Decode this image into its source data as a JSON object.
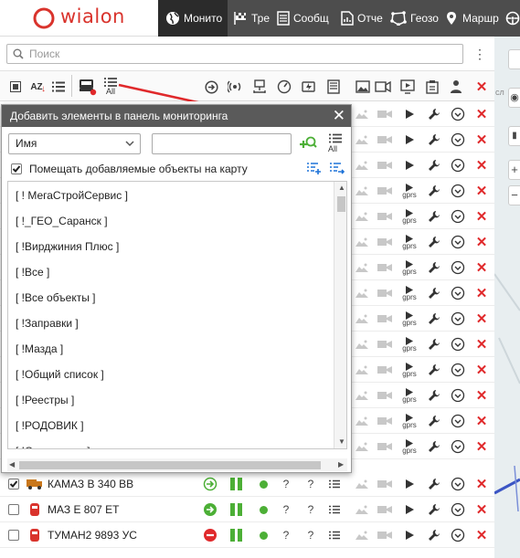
{
  "header": {
    "logo_text": "wialon",
    "tabs": [
      {
        "label": "Монито",
        "icon": "globe-icon"
      },
      {
        "label": "Тре",
        "icon": "flag-icon"
      },
      {
        "label": "Сообщ",
        "icon": "messages-icon"
      },
      {
        "label": "Отче",
        "icon": "reports-icon"
      },
      {
        "label": "Геозо",
        "icon": "geofence-icon"
      },
      {
        "label": "Маршр",
        "icon": "route-icon"
      },
      {
        "label": "",
        "icon": "steering-wheel-icon"
      }
    ]
  },
  "search": {
    "placeholder": "Поиск"
  },
  "toolbar": {
    "sort_label": "AZ",
    "all_label": "All"
  },
  "dialog": {
    "title": "Добавить элементы в панель мониторинга",
    "filter_select": "Имя",
    "filter_input_value": "",
    "all_label": "All",
    "checkbox_label": "Помещать добавляемые объекты на карту",
    "groups": [
      "[ ! МегаСтройСервис ]",
      "[ !_ГЕО_Саранск ]",
      "[ !Вирджиния Плюс ]",
      "[ !Все ]",
      "[ !Все объекты ]",
      "[ !Заправки ]",
      "[ !Мазда ]",
      "[ !Общий список ]",
      "[ !Реестры ]",
      "[ !РОДОВИК ]",
      "[ !Самосвалы ]"
    ]
  },
  "units": [
    {
      "name": "КАМАЗ В 340 ВВ",
      "checked": true,
      "status": "moving"
    },
    {
      "name": "МАЗ Е 807 ЕТ",
      "checked": false,
      "status": "ok"
    },
    {
      "name": "ТУМАН2 9893 УС",
      "checked": false,
      "status": "blocked"
    }
  ],
  "row_labels": {
    "question": "?",
    "gprs": "gprs"
  },
  "colors": {
    "header_bg": "#4d4d4d",
    "active_tab_bg": "#2b2b2b",
    "brand_red": "#d9332c",
    "delete_red": "#e0292b",
    "status_green": "#4caf36",
    "accent_blue": "#1e73d8"
  }
}
